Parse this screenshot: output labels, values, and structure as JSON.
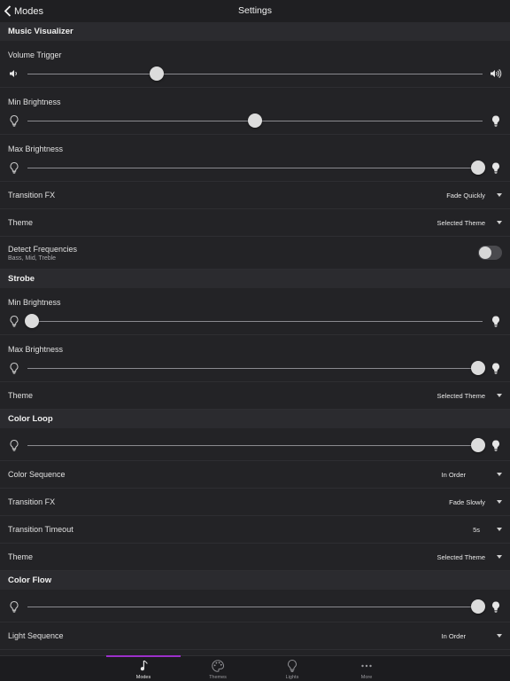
{
  "navbar": {
    "back_label": "Modes",
    "title": "Settings"
  },
  "sections": {
    "music": {
      "header": "Music Visualizer",
      "volume_trigger": {
        "label": "Volume Trigger",
        "value": 0.28
      },
      "min_brightness": {
        "label": "Min Brightness",
        "value": 0.5
      },
      "max_brightness": {
        "label": "Max Brightness",
        "value": 1.0
      },
      "transition_fx": {
        "label": "Transition FX",
        "value": "Fade Quickly"
      },
      "theme": {
        "label": "Theme",
        "value": "Selected Theme"
      },
      "detect_frequencies": {
        "label": "Detect Frequencies",
        "sublabel": "Bass, Mid, Treble",
        "on": false
      }
    },
    "strobe": {
      "header": "Strobe",
      "min_brightness": {
        "label": "Min Brightness",
        "value": 0.0
      },
      "max_brightness": {
        "label": "Max Brightness",
        "value": 1.0
      },
      "theme": {
        "label": "Theme",
        "value": "Selected Theme"
      }
    },
    "color_loop": {
      "header": "Color Loop",
      "brightness": {
        "value": 1.0
      },
      "color_sequence": {
        "label": "Color Sequence",
        "value": "In Order"
      },
      "transition_fx": {
        "label": "Transition FX",
        "value": "Fade Slowly"
      },
      "transition_timeout": {
        "label": "Transition Timeout",
        "value": "5s"
      },
      "theme": {
        "label": "Theme",
        "value": "Selected Theme"
      }
    },
    "color_flow": {
      "header": "Color Flow",
      "brightness": {
        "value": 1.0
      },
      "light_sequence": {
        "label": "Light Sequence",
        "value": "In Order"
      }
    }
  },
  "tabbar": {
    "items": [
      {
        "label": "Modes",
        "icon": "music-note-icon",
        "active": true
      },
      {
        "label": "Themes",
        "icon": "palette-icon",
        "active": false
      },
      {
        "label": "Lights",
        "icon": "bulb-icon",
        "active": false
      },
      {
        "label": "More",
        "icon": "more-icon",
        "active": false
      }
    ]
  },
  "colors": {
    "accent": "#9b2fc9",
    "background": "#232326",
    "section": "#2b2b2f"
  }
}
